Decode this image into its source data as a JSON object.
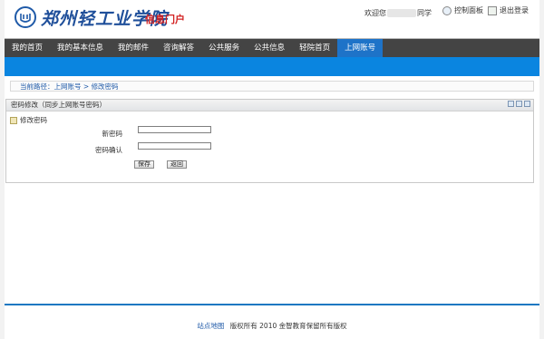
{
  "header": {
    "school_name": "郑州轻工业学院",
    "portal_label": "信息门户",
    "welcome_prefix": "欢迎您",
    "welcome_suffix": "同学",
    "control_panel_label": "控制面板",
    "logout_label": "退出登录",
    "logo_icon": "school-emblem-icon",
    "control_panel_icon": "control-panel-icon",
    "logout_icon": "logout-icon"
  },
  "nav": {
    "items": [
      "我的首页",
      "我的基本信息",
      "我的邮件",
      "咨询解答",
      "公共服务",
      "公共信息",
      "轻院首页",
      "上网账号"
    ],
    "active": "上网账号"
  },
  "breadcrumb": {
    "prefix": "当前路径：",
    "path1": "上网账号",
    "sep": " > ",
    "path2": "修改密码"
  },
  "panel": {
    "title": "密码修改（同步上网账号密码）",
    "section": "修改密码",
    "new_password_label": "新密码",
    "confirm_password_label": "密码确认",
    "new_password_value": "",
    "confirm_password_value": "",
    "save_label": "保存",
    "back_label": "返回"
  },
  "footer": {
    "sitemap": "站点地图",
    "copyright": "版权所有 2010 金智教育保留所有版权"
  },
  "colors": {
    "nav_bg": "#444444",
    "nav_active": "#1e73c8",
    "blue_band": "#0a85e0",
    "portal_red": "#d21f1f",
    "link_blue": "#1f5aa8"
  }
}
